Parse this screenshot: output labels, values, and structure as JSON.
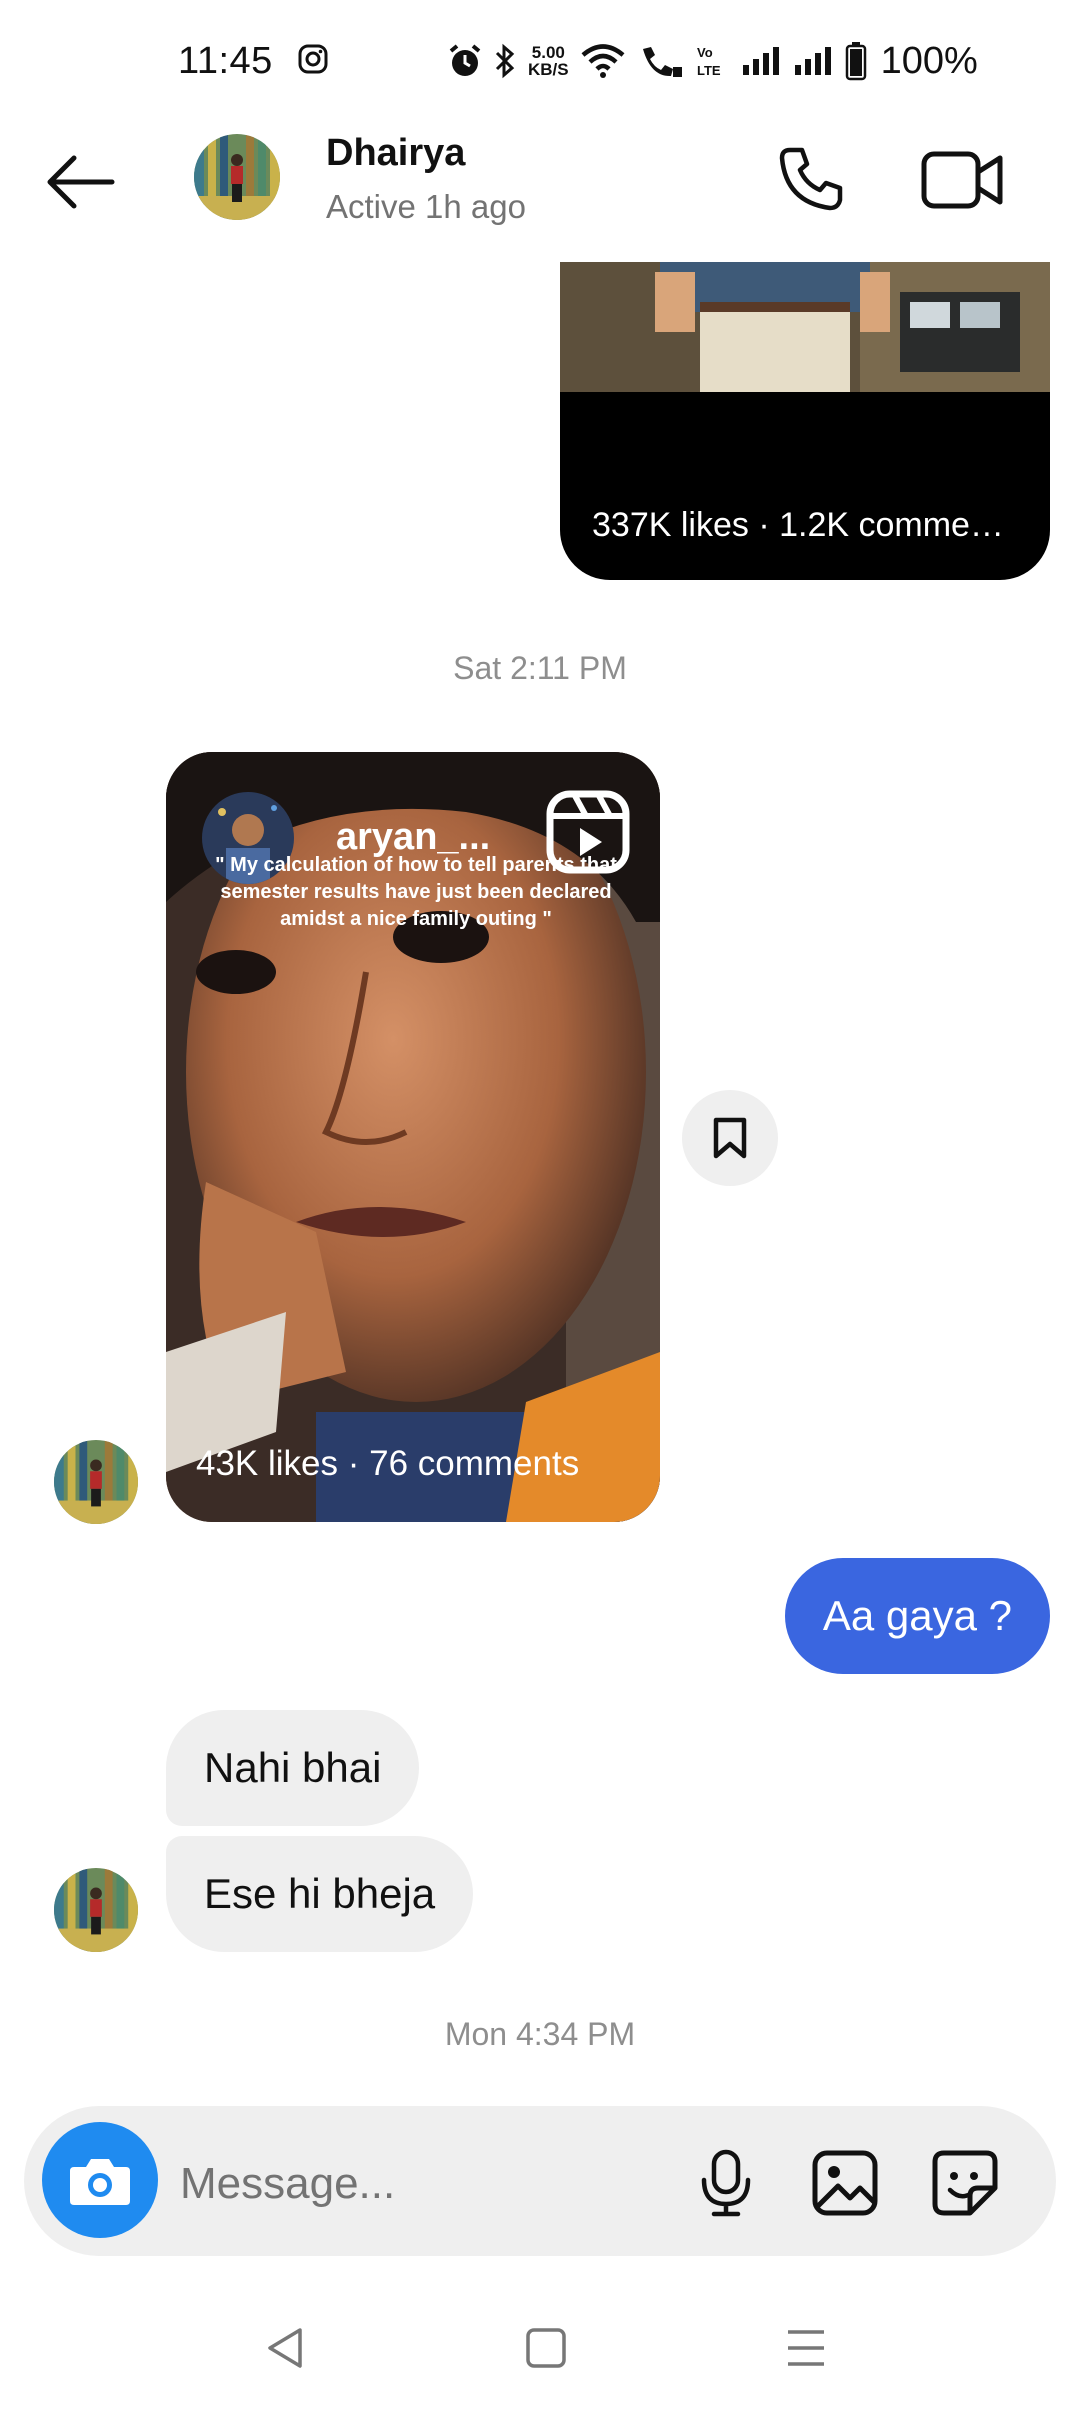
{
  "status_bar": {
    "time": "11:45",
    "network_speed_value": "5.00",
    "network_speed_unit": "KB/S",
    "battery": "100%"
  },
  "header": {
    "contact_name": "Dhairya",
    "contact_status": "Active 1h ago"
  },
  "messages": {
    "reel1_meta": "337K likes · 1.2K comme…",
    "timestamp1": "Sat 2:11 PM",
    "reel2": {
      "username": "aryan_...",
      "caption": "\" My calculation of how to tell parents that semester results have just been declared amidst a nice family outing \"",
      "meta": "43K likes · 76 comments"
    },
    "sent_text": "Aa gaya ?",
    "received_1": "Nahi bhai",
    "received_2": "Ese hi bheja",
    "timestamp2": "Mon 4:34 PM"
  },
  "composer": {
    "placeholder": "Message..."
  },
  "colors": {
    "sent_bubble": "#3a66e0",
    "received_bubble": "#efefef",
    "camera_button": "#1f8bf0"
  }
}
